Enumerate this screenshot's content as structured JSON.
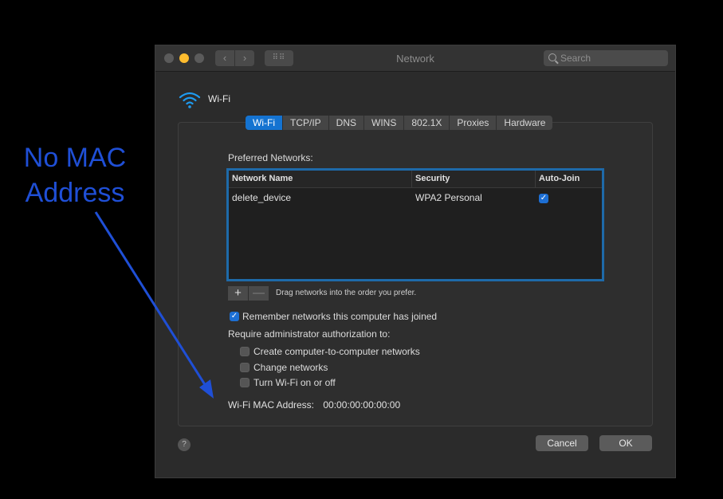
{
  "annotation": {
    "line1": "No MAC",
    "line2": "Address",
    "color": "#1f4fd6"
  },
  "window": {
    "title": "Network",
    "search_placeholder": "Search",
    "back_icon": "‹",
    "forward_icon": "›",
    "grid_icon": "⠿⠿"
  },
  "interface": {
    "name": "Wi-Fi",
    "icon": "wifi-icon",
    "accent": "#1e9bf0"
  },
  "tabs": [
    {
      "label": "Wi-Fi",
      "active": true
    },
    {
      "label": "TCP/IP",
      "active": false
    },
    {
      "label": "DNS",
      "active": false
    },
    {
      "label": "WINS",
      "active": false
    },
    {
      "label": "802.1X",
      "active": false
    },
    {
      "label": "Proxies",
      "active": false
    },
    {
      "label": "Hardware",
      "active": false
    }
  ],
  "preferred": {
    "label": "Preferred Networks:",
    "columns": [
      "Network Name",
      "Security",
      "Auto-Join"
    ],
    "rows": [
      {
        "name": "delete_device",
        "security": "WPA2 Personal",
        "auto_join": true
      }
    ],
    "add_label": "+",
    "remove_label": "—",
    "drag_hint": "Drag networks into the order you prefer."
  },
  "options": {
    "remember_label": "Remember networks this computer has joined",
    "remember_checked": true,
    "require_label": "Require administrator authorization to:",
    "create_label": "Create computer-to-computer networks",
    "create_checked": false,
    "change_label": "Change networks",
    "change_checked": false,
    "turn_label": "Turn Wi-Fi on or off",
    "turn_checked": false
  },
  "mac": {
    "label": "Wi-Fi MAC Address:",
    "value": "00:00:00:00:00:00"
  },
  "footer": {
    "help": "?",
    "cancel": "Cancel",
    "ok": "OK"
  }
}
